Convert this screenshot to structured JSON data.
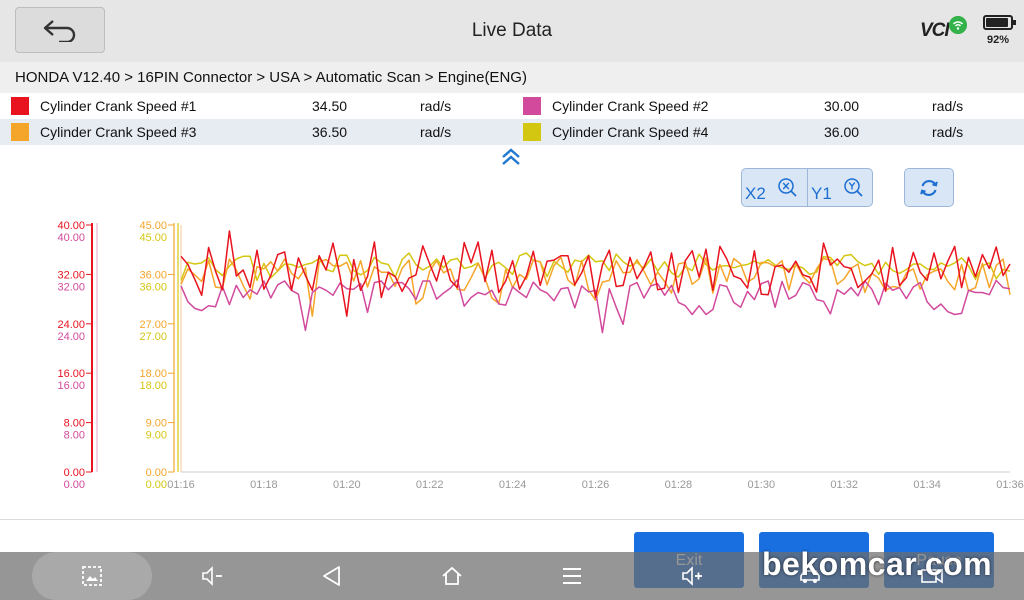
{
  "header": {
    "title": "Live Data",
    "vci_label": "VCI",
    "battery_percent": "92%",
    "battery_level": 0.92
  },
  "breadcrumb": "HONDA V12.40 > 16PIN Connector  > USA  > Automatic Scan  > Engine(ENG)",
  "parameters": [
    {
      "name": "Cylinder Crank Speed #1",
      "value": "34.50",
      "unit": "rad/s",
      "color": "#e8131f"
    },
    {
      "name": "Cylinder Crank Speed #2",
      "value": "30.00",
      "unit": "rad/s",
      "color": "#d24a9c"
    },
    {
      "name": "Cylinder Crank Speed #3",
      "value": "36.50",
      "unit": "rad/s",
      "color": "#f5a52a"
    },
    {
      "name": "Cylinder Crank Speed #4",
      "value": "36.00",
      "unit": "rad/s",
      "color": "#d4c712"
    }
  ],
  "controls": {
    "x_zoom_label": "X2",
    "y_zoom_label": "Y1"
  },
  "actions": {
    "exit_label": "Exit",
    "record_label": "",
    "pause_label": "Pause"
  },
  "watermark": "bekomcar.com",
  "icons": [
    "back-arrow-icon",
    "wifi-icon",
    "battery-icon",
    "double-chevron-up-icon",
    "zoom-x-icon",
    "zoom-y-icon",
    "refresh-icon",
    "screenshot-icon",
    "volume-down-icon",
    "nav-back-icon",
    "nav-home-icon",
    "nav-menu-icon",
    "volume-up-icon",
    "car-icon",
    "video-icon"
  ],
  "chart_data": {
    "type": "line",
    "x_tick_labels": [
      "01:16",
      "01:18",
      "01:20",
      "01:22",
      "01:24",
      "01:26",
      "01:28",
      "01:30",
      "01:32",
      "01:34",
      "01:36"
    ],
    "x_range": [
      0,
      120
    ],
    "axis1": {
      "ticks": [
        [
          "40.00",
          "40.00"
        ],
        [
          "32.00",
          "32.00"
        ],
        [
          "24.00",
          "24.00"
        ],
        [
          "16.00",
          "16.00"
        ],
        [
          "8.00",
          "8.00"
        ],
        [
          "0.00",
          "0.00"
        ]
      ],
      "color": "#e8131f"
    },
    "axis2": {
      "ticks": [
        [
          "45.00",
          "45.00"
        ],
        [
          "36.00",
          "36.00"
        ],
        [
          "27.00",
          "27.00"
        ],
        [
          "18.00",
          "18.00"
        ],
        [
          "9.00",
          "9.00"
        ],
        [
          "0.00",
          "0.00"
        ]
      ],
      "color": "#d4c712"
    },
    "y_range": [
      0,
      45
    ],
    "grid": false,
    "series": [
      {
        "name": "Cylinder Crank Speed #1",
        "color": "#e8131f",
        "values": [
          39.3,
          37.8,
          35.1,
          32.2,
          40.9,
          36.6,
          33.2,
          43.9,
          35.7,
          36.8,
          33.6,
          40.4,
          33.3,
          35.8,
          39.6,
          40.1,
          33.1,
          39.0,
          35.8,
          33.1,
          39.4,
          36.8,
          41.7,
          35.8,
          28.4,
          38.7,
          33.1,
          35.6,
          41.9,
          31.8,
          36.4,
          35.6,
          32.9,
          35.3,
          35.9,
          41.2,
          37.9,
          34.8,
          39.4,
          34.9,
          33.6,
          41.8,
          38.1,
          41.9,
          34.7,
          40.4,
          32.7,
          34.8,
          38.5,
          33.3,
          35.7,
          40.2,
          34.0,
          38.4,
          38.6,
          39.4,
          39.4,
          34.1,
          36.3,
          39.4,
          31.8,
          37.7,
          40.4,
          33.8,
          34.0,
          39.1,
          35.2,
          37.3,
          40.1,
          33.2,
          33.5,
          39.9,
          32.7,
          38.5,
          40.3,
          35.5,
          40.6,
          33.1,
          41.1,
          38.8,
          35.7,
          35.2,
          33.5,
          40.3,
          32.4,
          32.3,
          37.4,
          37.7,
          36.4,
          38.4,
          35.9,
          35.5,
          32.8,
          41.7,
          37.7,
          38.8,
          37.4,
          37.1,
          33.6,
          34.8,
          36.1,
          38.6,
          32.9,
          40.9,
          34.0,
          35.4,
          40.0,
          36.4,
          34.9,
          39.9,
          35.2,
          38.4,
          41.1,
          33.6,
          39.1,
          35.6,
          39.6,
          37.1,
          41.0,
          35.8,
          37.9
        ]
      },
      {
        "name": "Cylinder Crank Speed #2",
        "color": "#d24a9c",
        "values": [
          33.9,
          31.0,
          29.8,
          29.4,
          30.3,
          30.1,
          33.8,
          30.5,
          34.0,
          31.8,
          33.2,
          32.4,
          34.8,
          31.7,
          34.1,
          34.8,
          33.1,
          32.4,
          25.8,
          32.7,
          33.7,
          33.1,
          32.2,
          34.4,
          33.4,
          33.3,
          34.3,
          29.1,
          34.5,
          34.8,
          33.2,
          34.5,
          34.5,
          33.4,
          31.4,
          34.8,
          34.8,
          31.5,
          32.6,
          33.5,
          35.0,
          30.2,
          31.8,
          32.7,
          32.3,
          33.1,
          30.6,
          30.4,
          33.7,
          32.7,
          31.8,
          34.6,
          33.2,
          32.6,
          31.2,
          33.4,
          33.6,
          29.9,
          33.9,
          32.8,
          33.1,
          25.4,
          33.4,
          30.0,
          26.9,
          33.9,
          34.5,
          31.7,
          33.9,
          34.3,
          32.2,
          34.0,
          30.9,
          30.3,
          28.7,
          30.3,
          28.7,
          29.6,
          34.1,
          33.8,
          30.9,
          30.0,
          32.9,
          31.4,
          34.3,
          34.8,
          30.0,
          34.7,
          31.5,
          32.2,
          34.5,
          34.0,
          31.4,
          31.1,
          28.8,
          33.2,
          32.4,
          33.6,
          32.1,
          34.8,
          33.3,
          30.5,
          34.4,
          33.1,
          33.6,
          31.6,
          33.7,
          34.5,
          31.0,
          29.6,
          30.6,
          29.2,
          28.7,
          28.9,
          33.1,
          32.7,
          32.7,
          32.3,
          34.9,
          33.6,
          33.4
        ]
      },
      {
        "name": "Cylinder Crank Speed #3",
        "color": "#f5a52a",
        "values": [
          34.2,
          37.0,
          35.9,
          34.7,
          38.5,
          33.7,
          33.5,
          38.8,
          36.8,
          34.0,
          31.5,
          37.4,
          37.0,
          38.3,
          36.6,
          38.8,
          36.2,
          35.2,
          37.2,
          28.4,
          38.3,
          38.7,
          37.6,
          37.5,
          38.2,
          34.8,
          38.5,
          33.7,
          37.4,
          36.4,
          36.4,
          33.8,
          37.1,
          38.6,
          30.6,
          31.7,
          36.6,
          38.5,
          36.3,
          37.0,
          33.3,
          33.1,
          35.4,
          38.0,
          35.3,
          31.7,
          30.7,
          36.9,
          33.6,
          36.0,
          35.1,
          38.6,
          38.3,
          34.1,
          37.6,
          39.1,
          35.0,
          33.9,
          38.5,
          33.2,
          31.3,
          34.6,
          34.9,
          38.5,
          36.3,
          36.4,
          38.7,
          36.6,
          34.1,
          36.4,
          34.7,
          32.6,
          37.9,
          38.2,
          34.2,
          35.2,
          39.0,
          32.6,
          37.8,
          34.7,
          38.9,
          37.9,
          34.6,
          35.4,
          38.2,
          38.1,
          37.4,
          38.5,
          33.2,
          38.0,
          35.6,
          34.4,
          37.0,
          38.9,
          38.6,
          34.2,
          35.2,
          37.1,
          37.9,
          32.7,
          36.2,
          35.3,
          33.1,
          33.8,
          33.6,
          36.3,
          37.0,
          33.3,
          35.9,
          36.6,
          37.0,
          34.7,
          33.2,
          37.8,
          33.0,
          33.6,
          38.0,
          33.6,
          37.6,
          38.8,
          32.3
        ]
      },
      {
        "name": "Cylinder Crank Speed #4",
        "color": "#d4c712",
        "values": [
          34.9,
          38.2,
          37.9,
          38.1,
          39.0,
          36.9,
          35.8,
          37.5,
          38.8,
          39.3,
          39.3,
          34.9,
          38.0,
          35.4,
          36.6,
          37.9,
          37.8,
          37.3,
          37.8,
          38.1,
          38.9,
          36.9,
          36.5,
          39.5,
          39.5,
          36.7,
          35.9,
          36.7,
          39.1,
          38.1,
          37.8,
          35.5,
          38.7,
          39.9,
          37.8,
          36.8,
          37.5,
          38.8,
          37.2,
          38.6,
          38.9,
          37.1,
          37.4,
          38.1,
          35.3,
          37.6,
          38.2,
          37.2,
          36.0,
          39.4,
          39.9,
          38.6,
          38.3,
          35.6,
          38.4,
          37.4,
          36.4,
          38.6,
          38.3,
          39.5,
          38.3,
          38.5,
          36.7,
          39.7,
          38.3,
          37.5,
          38.2,
          37.1,
          38.8,
          36.6,
          38.3,
          36.3,
          35.5,
          37.4,
          36.7,
          39.7,
          37.8,
          36.8,
          37.5,
          37.6,
          37.2,
          37.6,
          37.8,
          38.4,
          37.9,
          38.7,
          37.7,
          37.2,
          36.9,
          37.6,
          37.2,
          36.0,
          36.4,
          39.2,
          39.1,
          37.6,
          39.4,
          39.6,
          38.3,
          37.6,
          38.0,
          36.0,
          38.2,
          36.7,
          36.2,
          36.9,
          37.9,
          37.9,
          37.0,
          36.9,
          38.1,
          37.5,
          38.1,
          39.0,
          37.6,
          35.1,
          37.6,
          38.1,
          35.2,
          36.9,
          36.6
        ]
      }
    ]
  }
}
